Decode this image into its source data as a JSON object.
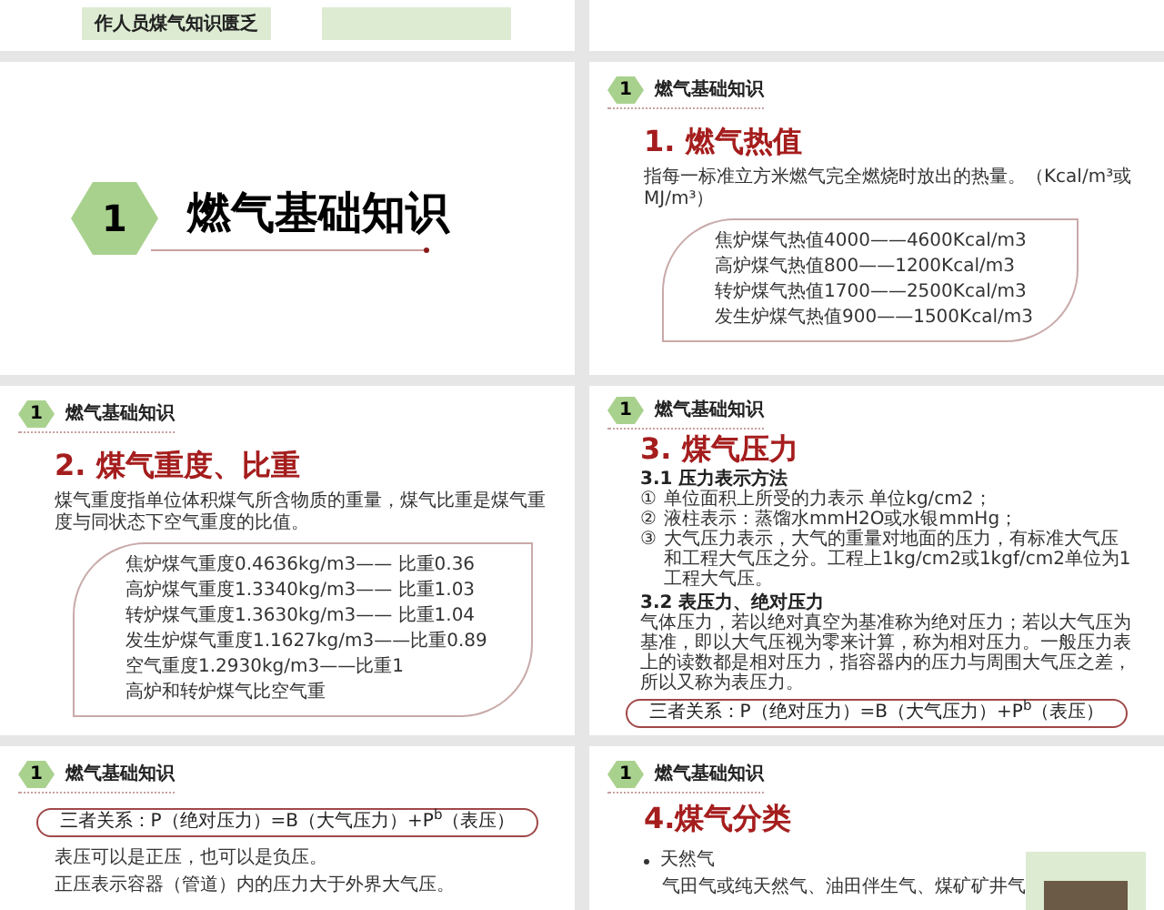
{
  "slides": [
    {
      "kind": "cut_boxes",
      "boxes": [
        {
          "text": "作人员煤气知识匮乏"
        }
      ]
    },
    {
      "kind": "blank"
    },
    {
      "kind": "section",
      "number": "1",
      "title": "燃气基础知识"
    },
    {
      "kind": "list_box",
      "badge": "1",
      "section": "燃气基础知识",
      "title": "1. 燃气热值",
      "description": "指每一标准立方米燃气完全燃烧时放出的热量。（Kcal/m³或MJ/m³）",
      "lines": [
        "焦炉煤气热值4000——4600Kcal/m3",
        "高炉煤气热值800——1200Kcal/m3",
        "转炉煤气热值1700——2500Kcal/m3",
        "发生炉煤气热值900——1500Kcal/m3"
      ]
    },
    {
      "kind": "list_box",
      "badge": "1",
      "section": "燃气基础知识",
      "title": "2. 煤气重度、比重",
      "description": "煤气重度指单位体积煤气所含物质的重量，煤气比重是煤气重度与同状态下空气重度的比值。",
      "lines": [
        "焦炉煤气重度0.4636kg/m3—— 比重0.36",
        "高炉煤气重度1.3340kg/m3—— 比重1.03",
        "转炉煤气重度1.3630kg/m3—— 比重1.04",
        "发生炉煤气重度1.1627kg/m3——比重0.89",
        "空气重度1.2930kg/m3——比重1",
        "高炉和转炉煤气比空气重"
      ]
    },
    {
      "kind": "pressure",
      "badge": "1",
      "section": "燃气基础知识",
      "title": "3. 煤气压力",
      "heading_1": "3.1 压力表示方法",
      "items": [
        {
          "marker": "①",
          "text": "单位面积上所受的力表示 单位kg/cm2；"
        },
        {
          "marker": "②",
          "text": "液柱表示：蒸馏水mmH2O或水银mmHg；"
        },
        {
          "marker": "③",
          "text": "大气压力表示，大气的重量对地面的压力，有标准大气压和工程大气压之分。工程上1kg/cm2或1kgf/cm2单位为1工程大气压。"
        }
      ],
      "heading_2": "3.2 表压力、绝对压力",
      "paragraph": "气体压力，若以绝对真空为基准称为绝对压力；若以大气压为基准，即以大气压视为零来计算，称为相对压力。一般压力表上的读数都是相对压力，指容器内的压力与周围大气压之差，所以又称为表压力。",
      "formula": "三者关系：P（绝对压力）=B（大气压力）+P$^{b}$（表压）"
    },
    {
      "kind": "notes",
      "badge": "1",
      "section": "燃气基础知识",
      "formula": "三者关系：P（绝对压力）=B（大气压力）+P$^{b}$（表压）",
      "lines": [
        "表压可以是正压，也可以是负压。",
        "正压表示容器（管道）内的压力大于外界大气压。"
      ]
    },
    {
      "kind": "bullets",
      "badge": "1",
      "section": "燃气基础知识",
      "title": "4.煤气分类",
      "bullets": [
        {
          "text": "天然气",
          "detail": "气田气或纯天然气、油田伴生气、煤矿矿井气"
        }
      ]
    }
  ]
}
